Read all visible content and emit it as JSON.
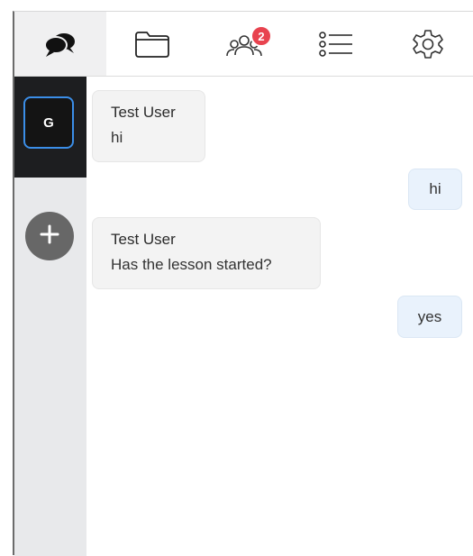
{
  "tabs": [
    {
      "name": "chats",
      "icon": "chat-bubbles-icon",
      "active": true
    },
    {
      "name": "files",
      "icon": "folder-icon",
      "active": false
    },
    {
      "name": "participants",
      "icon": "people-icon",
      "active": false,
      "badge": "2"
    },
    {
      "name": "list",
      "icon": "list-icon",
      "active": false
    },
    {
      "name": "settings",
      "icon": "gear-icon",
      "active": false
    }
  ],
  "sidebar": {
    "active_workspace_initial": "G",
    "add_icon": "plus-icon"
  },
  "messages": [
    {
      "direction": "incoming",
      "sender": "Test User",
      "text": "hi"
    },
    {
      "direction": "outgoing",
      "text": "hi"
    },
    {
      "direction": "incoming",
      "sender": "Test User",
      "text": "Has the lesson started?"
    },
    {
      "direction": "outgoing",
      "text": "yes"
    }
  ],
  "colors": {
    "badge": "#e8434f",
    "active_border": "#3b8ee8",
    "incoming_bubble": "#f3f3f3",
    "outgoing_bubble": "#e9f2fc",
    "sidebar_bg": "#e8e9eb",
    "active_workspace_bg": "#1d1e20"
  }
}
